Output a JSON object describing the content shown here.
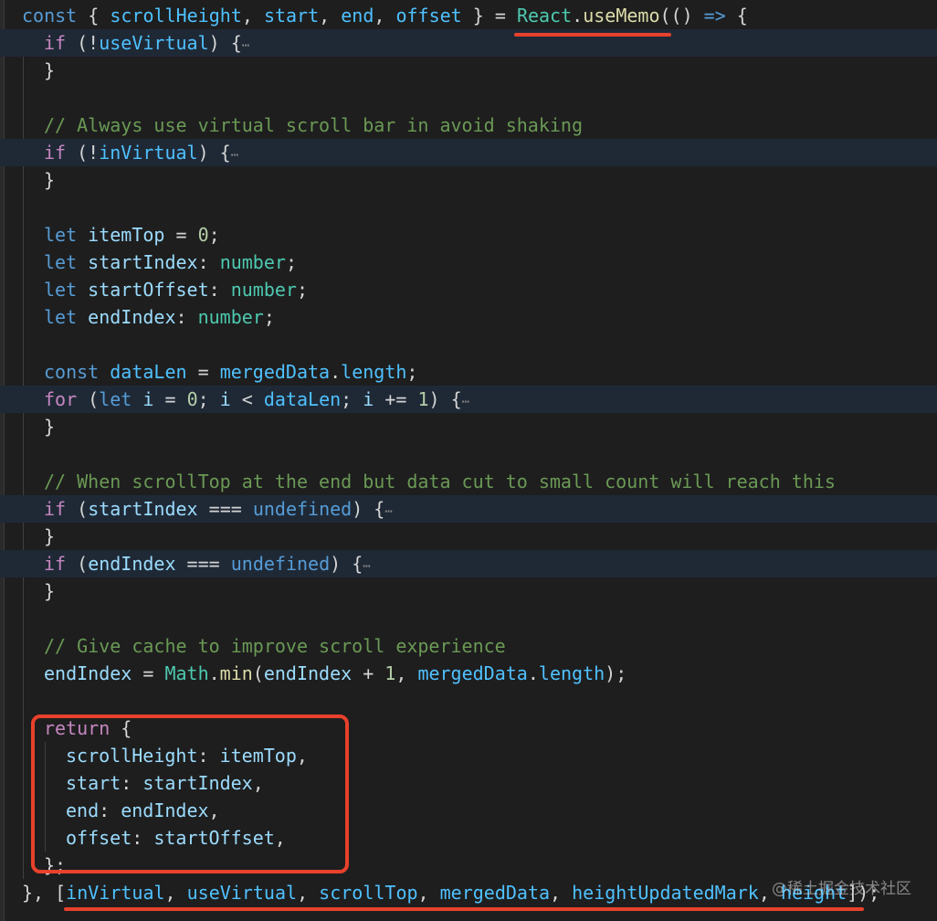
{
  "editor": {
    "theme_colors": {
      "background": "#1e1e1e",
      "highlight": "#1f2936",
      "keyword": "#569cd6",
      "control": "#c586c0",
      "variable": "#4fc1ff",
      "comment": "#6a9955",
      "type": "#4ec9b0",
      "number": "#b5cea8",
      "function": "#dcdcaa",
      "annotation": "#e8412c"
    },
    "lines": [
      {
        "indent": 0,
        "tokens": [
          [
            "const",
            "kw"
          ],
          [
            " { ",
            "p"
          ],
          [
            "scrollHeight",
            "var"
          ],
          [
            ", ",
            "p"
          ],
          [
            "start",
            "var"
          ],
          [
            ", ",
            "p"
          ],
          [
            "end",
            "var"
          ],
          [
            ", ",
            "p"
          ],
          [
            "offset",
            "var"
          ],
          [
            " } = ",
            "p"
          ],
          [
            "React",
            "ty"
          ],
          [
            ".",
            "p"
          ],
          [
            "useMemo",
            "fn"
          ],
          [
            "(() ",
            "p"
          ],
          [
            "=>",
            "kw"
          ],
          [
            " {",
            "p"
          ]
        ]
      },
      {
        "indent": 1,
        "hl": true,
        "tokens": [
          [
            "if",
            "ctl"
          ],
          [
            " (!",
            "p"
          ],
          [
            "useVirtual",
            "var"
          ],
          [
            ") {",
            "p"
          ],
          [
            "⋯",
            "fold"
          ]
        ]
      },
      {
        "indent": 1,
        "tokens": [
          [
            "}",
            "p"
          ]
        ]
      },
      {
        "indent": 0,
        "tokens": []
      },
      {
        "indent": 1,
        "tokens": [
          [
            "// Always use virtual scroll bar in avoid shaking",
            "cm"
          ]
        ]
      },
      {
        "indent": 1,
        "hl": true,
        "tokens": [
          [
            "if",
            "ctl"
          ],
          [
            " (!",
            "p"
          ],
          [
            "inVirtual",
            "var"
          ],
          [
            ") {",
            "p"
          ],
          [
            "⋯",
            "fold"
          ]
        ]
      },
      {
        "indent": 1,
        "tokens": [
          [
            "}",
            "p"
          ]
        ]
      },
      {
        "indent": 0,
        "tokens": []
      },
      {
        "indent": 1,
        "tokens": [
          [
            "let",
            "kw"
          ],
          [
            " ",
            "p"
          ],
          [
            "itemTop",
            "prop"
          ],
          [
            " = ",
            "p"
          ],
          [
            "0",
            "num"
          ],
          [
            ";",
            "p"
          ]
        ]
      },
      {
        "indent": 1,
        "tokens": [
          [
            "let",
            "kw"
          ],
          [
            " ",
            "p"
          ],
          [
            "startIndex",
            "prop"
          ],
          [
            ": ",
            "p"
          ],
          [
            "number",
            "ty"
          ],
          [
            ";",
            "p"
          ]
        ]
      },
      {
        "indent": 1,
        "tokens": [
          [
            "let",
            "kw"
          ],
          [
            " ",
            "p"
          ],
          [
            "startOffset",
            "prop"
          ],
          [
            ": ",
            "p"
          ],
          [
            "number",
            "ty"
          ],
          [
            ";",
            "p"
          ]
        ]
      },
      {
        "indent": 1,
        "tokens": [
          [
            "let",
            "kw"
          ],
          [
            " ",
            "p"
          ],
          [
            "endIndex",
            "prop"
          ],
          [
            ": ",
            "p"
          ],
          [
            "number",
            "ty"
          ],
          [
            ";",
            "p"
          ]
        ]
      },
      {
        "indent": 0,
        "tokens": []
      },
      {
        "indent": 1,
        "tokens": [
          [
            "const",
            "kw"
          ],
          [
            " ",
            "p"
          ],
          [
            "dataLen",
            "var"
          ],
          [
            " = ",
            "p"
          ],
          [
            "mergedData",
            "var"
          ],
          [
            ".",
            "p"
          ],
          [
            "length",
            "var"
          ],
          [
            ";",
            "p"
          ]
        ]
      },
      {
        "indent": 1,
        "hl": true,
        "tokens": [
          [
            "for",
            "ctl"
          ],
          [
            " (",
            "p"
          ],
          [
            "let",
            "kw"
          ],
          [
            " ",
            "p"
          ],
          [
            "i",
            "prop"
          ],
          [
            " = ",
            "p"
          ],
          [
            "0",
            "num"
          ],
          [
            "; ",
            "p"
          ],
          [
            "i",
            "prop"
          ],
          [
            " < ",
            "p"
          ],
          [
            "dataLen",
            "var"
          ],
          [
            "; ",
            "p"
          ],
          [
            "i",
            "prop"
          ],
          [
            " += ",
            "p"
          ],
          [
            "1",
            "num"
          ],
          [
            ") {",
            "p"
          ],
          [
            "⋯",
            "fold"
          ]
        ]
      },
      {
        "indent": 1,
        "tokens": [
          [
            "}",
            "p"
          ]
        ]
      },
      {
        "indent": 0,
        "tokens": []
      },
      {
        "indent": 1,
        "tokens": [
          [
            "// When scrollTop at the end but data cut to small count will reach this",
            "cm"
          ]
        ]
      },
      {
        "indent": 1,
        "hl": true,
        "tokens": [
          [
            "if",
            "ctl"
          ],
          [
            " (",
            "p"
          ],
          [
            "startIndex",
            "prop"
          ],
          [
            " === ",
            "p"
          ],
          [
            "undefined",
            "kw"
          ],
          [
            ") {",
            "p"
          ],
          [
            "⋯",
            "fold"
          ]
        ]
      },
      {
        "indent": 1,
        "tokens": [
          [
            "}",
            "p"
          ]
        ]
      },
      {
        "indent": 1,
        "hl": true,
        "tokens": [
          [
            "if",
            "ctl"
          ],
          [
            " (",
            "p"
          ],
          [
            "endIndex",
            "prop"
          ],
          [
            " === ",
            "p"
          ],
          [
            "undefined",
            "kw"
          ],
          [
            ") {",
            "p"
          ],
          [
            "⋯",
            "fold"
          ]
        ]
      },
      {
        "indent": 1,
        "tokens": [
          [
            "}",
            "p"
          ]
        ]
      },
      {
        "indent": 0,
        "tokens": []
      },
      {
        "indent": 1,
        "tokens": [
          [
            "// Give cache to improve scroll experience",
            "cm"
          ]
        ]
      },
      {
        "indent": 1,
        "tokens": [
          [
            "endIndex",
            "prop"
          ],
          [
            " = ",
            "p"
          ],
          [
            "Math",
            "ty"
          ],
          [
            ".",
            "p"
          ],
          [
            "min",
            "fn"
          ],
          [
            "(",
            "p"
          ],
          [
            "endIndex",
            "prop"
          ],
          [
            " + ",
            "p"
          ],
          [
            "1",
            "num"
          ],
          [
            ", ",
            "p"
          ],
          [
            "mergedData",
            "var"
          ],
          [
            ".",
            "p"
          ],
          [
            "length",
            "var"
          ],
          [
            ");",
            "p"
          ]
        ]
      },
      {
        "indent": 0,
        "tokens": []
      },
      {
        "indent": 1,
        "tokens": [
          [
            "return",
            "ctl"
          ],
          [
            " {",
            "p"
          ]
        ]
      },
      {
        "indent": 2,
        "tokens": [
          [
            "scrollHeight",
            "prop"
          ],
          [
            ": ",
            "p"
          ],
          [
            "itemTop",
            "prop"
          ],
          [
            ",",
            "p"
          ]
        ]
      },
      {
        "indent": 2,
        "tokens": [
          [
            "start",
            "prop"
          ],
          [
            ": ",
            "p"
          ],
          [
            "startIndex",
            "prop"
          ],
          [
            ",",
            "p"
          ]
        ]
      },
      {
        "indent": 2,
        "tokens": [
          [
            "end",
            "prop"
          ],
          [
            ": ",
            "p"
          ],
          [
            "endIndex",
            "prop"
          ],
          [
            ",",
            "p"
          ]
        ]
      },
      {
        "indent": 2,
        "tokens": [
          [
            "offset",
            "prop"
          ],
          [
            ": ",
            "p"
          ],
          [
            "startOffset",
            "prop"
          ],
          [
            ",",
            "p"
          ]
        ]
      },
      {
        "indent": 1,
        "tokens": [
          [
            "};",
            "p"
          ]
        ]
      },
      {
        "indent": 0,
        "tokens": [
          [
            "}, [",
            "p"
          ],
          [
            "inVirtual",
            "var"
          ],
          [
            ", ",
            "p"
          ],
          [
            "useVirtual",
            "var"
          ],
          [
            ", ",
            "p"
          ],
          [
            "scrollTop",
            "var"
          ],
          [
            ", ",
            "p"
          ],
          [
            "mergedData",
            "var"
          ],
          [
            ", ",
            "p"
          ],
          [
            "heightUpdatedMark",
            "var"
          ],
          [
            ", ",
            "p"
          ],
          [
            "height",
            "var"
          ],
          [
            "]);",
            "p"
          ]
        ]
      }
    ]
  },
  "watermark": "@稀土掘金技术社区"
}
